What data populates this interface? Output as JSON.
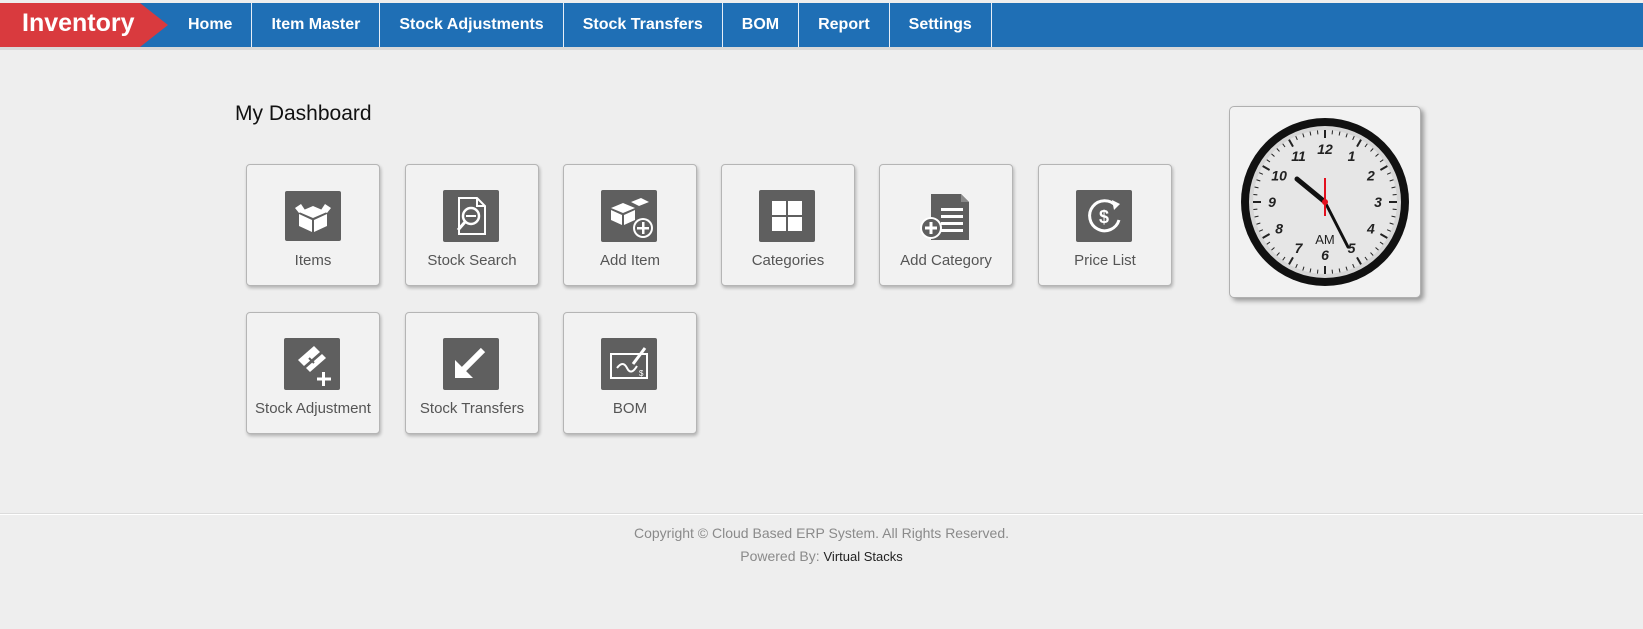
{
  "brand": "Inventory",
  "nav": [
    "Home",
    "Item Master",
    "Stock Adjustments",
    "Stock Transfers",
    "BOM",
    "Report",
    "Settings"
  ],
  "page_title": "My Dashboard",
  "tiles": [
    {
      "label": "Items",
      "icon": "box-icon"
    },
    {
      "label": "Stock Search",
      "icon": "document-search-icon"
    },
    {
      "label": "Add Item",
      "icon": "add-box-icon"
    },
    {
      "label": "Categories",
      "icon": "grid-icon"
    },
    {
      "label": "Add Category",
      "icon": "add-document-icon"
    },
    {
      "label": "Price List",
      "icon": "dollar-refresh-icon"
    },
    {
      "label": "Stock Adjustment",
      "icon": "ticket-add-icon"
    },
    {
      "label": "Stock Transfers",
      "icon": "arrow-down-left-icon"
    },
    {
      "label": "BOM",
      "icon": "cheque-sign-icon"
    }
  ],
  "clock": {
    "meridiem": "AM",
    "numerals": [
      "12",
      "1",
      "2",
      "3",
      "4",
      "5",
      "6",
      "7",
      "8",
      "9",
      "10",
      "11"
    ]
  },
  "footer": {
    "copyright": "Copyright © Cloud Based ERP System. All Rights Reserved.",
    "powered_label": "Powered By:",
    "powered_link": "Virtual Stacks"
  },
  "colors": {
    "nav_bg": "#1f6fb5",
    "brand_bg": "#d93a3e",
    "icon_bg": "#5f5f5f",
    "second_hand": "#e3101e"
  }
}
